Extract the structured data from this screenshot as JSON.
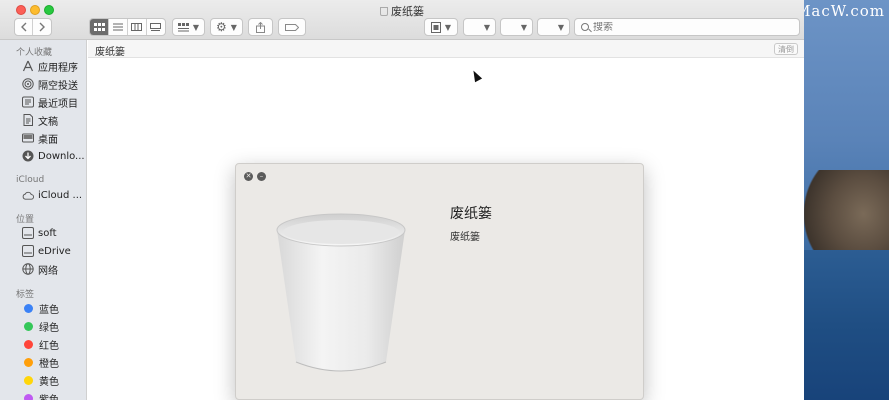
{
  "window": {
    "title": "废纸篓"
  },
  "watermark": {
    "text": "www.MacW.com"
  },
  "toolbar": {
    "back_icon": "chevron-left-icon",
    "forward_icon": "chevron-right-icon",
    "views": [
      "icon-view-icon",
      "list-view-icon",
      "column-view-icon",
      "gallery-view-icon"
    ],
    "group_icon": "group-by-icon",
    "action_icon": "gear-icon",
    "share_icon": "share-icon",
    "tag_icon": "tag-icon",
    "search_placeholder": "搜索"
  },
  "sidebar": {
    "favorites_header": "个人收藏",
    "favorites": [
      {
        "label": "应用程序",
        "icon": "applications-icon"
      },
      {
        "label": "隔空投送",
        "icon": "airdrop-icon"
      },
      {
        "label": "最近项目",
        "icon": "recents-icon"
      },
      {
        "label": "文稿",
        "icon": "documents-icon"
      },
      {
        "label": "桌面",
        "icon": "desktop-icon"
      },
      {
        "label": "Downlo...",
        "icon": "downloads-icon"
      }
    ],
    "icloud_header": "iCloud",
    "icloud": [
      {
        "label": "iCloud ...",
        "icon": "cloud-icon"
      }
    ],
    "locations_header": "位置",
    "locations": [
      {
        "label": "soft",
        "icon": "disk-icon"
      },
      {
        "label": "eDrive",
        "icon": "disk-icon"
      },
      {
        "label": "网络",
        "icon": "network-icon"
      }
    ],
    "tags_header": "标签",
    "tags": [
      {
        "label": "蓝色",
        "color": "#3b82f6"
      },
      {
        "label": "绿色",
        "color": "#34c759"
      },
      {
        "label": "红色",
        "color": "#ff453a"
      },
      {
        "label": "橙色",
        "color": "#ff9f0a"
      },
      {
        "label": "黄色",
        "color": "#ffd60a"
      },
      {
        "label": "紫色",
        "color": "#bf5af2"
      }
    ]
  },
  "pathbar": {
    "title": "废纸篓",
    "clear_label": "清倒"
  },
  "info_panel": {
    "title": "废纸篓",
    "subtitle": "废纸篓"
  }
}
